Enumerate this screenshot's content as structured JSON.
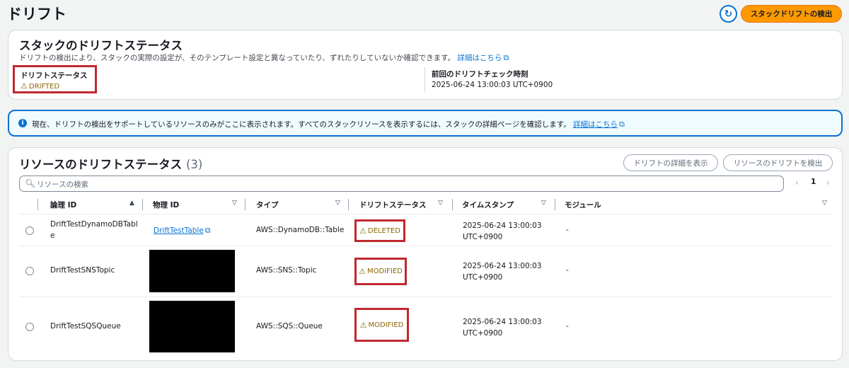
{
  "page": {
    "title": "ドリフト"
  },
  "header": {
    "detect_button": "スタックドリフトの検出",
    "refresh_icon": "refresh-icon"
  },
  "stack_status": {
    "title": "スタックのドリフトステータス",
    "description": "ドリフトの検出により、スタックの実際の設定が、そのテンプレート設定と異なっていたり、ずれたりしていないか確認できます。",
    "learn_more": "詳細はこちら",
    "drift_label": "ドリフトステータス",
    "drift_value": "DRIFTED",
    "last_check_label": "前回のドリフトチェック時刻",
    "last_check_value": "2025-06-24 13:00:03 UTC+0900",
    "colors": {
      "warning": "#8d6605",
      "highlight": "#c0282e"
    }
  },
  "info": {
    "text": "現在、ドリフトの検出をサポートしているリソースのみがここに表示されます。すべてのスタックリソースを表示するには、スタックの詳細ページを確認します。",
    "link": "詳細はこちら"
  },
  "resources": {
    "title": "リソースのドリフトステータス",
    "count": "(3)",
    "view_details_button": "ドリフトの詳細を表示",
    "detect_resource_button": "リソースのドリフトを検出",
    "search_placeholder": "リソースの検索",
    "page_number": "1",
    "columns": [
      "論理 ID",
      "物理 ID",
      "タイプ",
      "ドリフトステータス",
      "タイムスタンプ",
      "モジュール"
    ],
    "rows": [
      {
        "logical_id_1": "DriftTestDynamoDBTabl",
        "logical_id_2": "e",
        "physical_id": "DriftTestTable",
        "type": "AWS::DynamoDB::Table",
        "status": "DELETED",
        "timestamp_1": "2025-06-24 13:00:03",
        "timestamp_2": "UTC+0900",
        "module": "-"
      },
      {
        "logical_id": "DriftTestSNSTopic",
        "type": "AWS::SNS::Topic",
        "status": "MODIFIED",
        "timestamp_1": "2025-06-24 13:00:03",
        "timestamp_2": "UTC+0900",
        "module": "-"
      },
      {
        "logical_id": "DriftTestSQSQueue",
        "type": "AWS::SQS::Queue",
        "status": "MODIFIED",
        "timestamp_1": "2025-06-24 13:00:03",
        "timestamp_2": "UTC+0900",
        "module": "-"
      }
    ]
  }
}
